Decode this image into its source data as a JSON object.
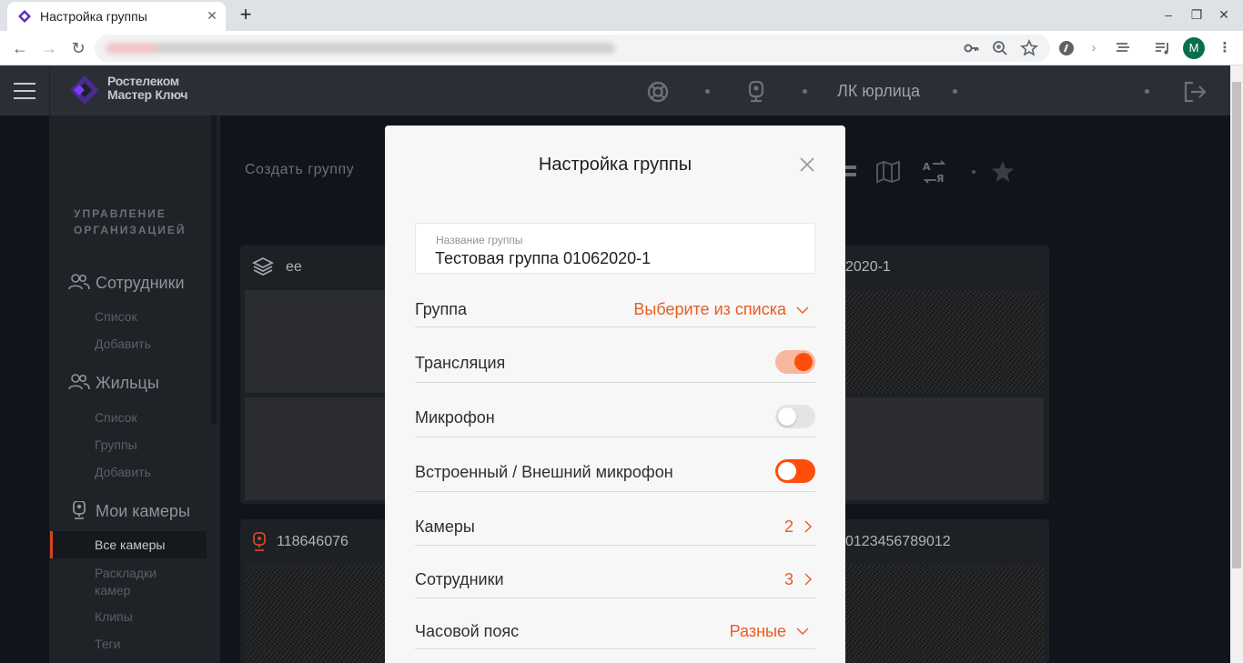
{
  "browser": {
    "tab_title": "Настройка группы",
    "tab_close": "✕",
    "new_tab": "+",
    "profile_initial": "M",
    "window_controls": [
      "–",
      "❐",
      "✕"
    ]
  },
  "header": {
    "logo_line1": "Ростелеком",
    "logo_line2": "Мастер Ключ",
    "account_label": "ЛК юрлица",
    "icons": [
      "support-icon",
      "camera-icon",
      "logout-icon"
    ]
  },
  "sidebar": {
    "heading_line1": "УПРАВЛЕНИЕ",
    "heading_line2": "ОРГАНИЗАЦИЕЙ",
    "sections": [
      {
        "label": "Сотрудники",
        "items": [
          "Список",
          "Добавить"
        ]
      },
      {
        "label": "Жильцы",
        "items": [
          "Список",
          "Группы",
          "Добавить"
        ]
      },
      {
        "label": "Мои камеры",
        "items": [
          "Все камеры",
          "Раскладки камер",
          "Клипы",
          "Теги"
        ]
      }
    ],
    "layouts_line1": "Раскладки",
    "layouts_line2": "камер",
    "active_item": "Все камеры"
  },
  "content": {
    "create_group": "Создать группу",
    "cards": [
      {
        "title": "ee"
      },
      {
        "title": "2020-1"
      },
      {
        "title": "118646076"
      },
      {
        "title": "0123456789012"
      }
    ]
  },
  "modal": {
    "title": "Настройка группы",
    "name_label": "Название группы",
    "name_value": "Тестовая группа 01062020-1",
    "group_label": "Группа",
    "group_value": "Выберите из списка",
    "broadcast_label": "Трансляция",
    "broadcast_on": true,
    "mic_label": "Микрофон",
    "mic_on": false,
    "ext_mic_label": "Встроенный / Внешний микрофон",
    "cameras_label": "Камеры",
    "cameras_count": "2",
    "employees_label": "Сотрудники",
    "employees_count": "3",
    "timezone_label": "Часовой пояс",
    "timezone_value": "Разные"
  },
  "colors": {
    "accent": "#ff4d0c",
    "accent_text": "#e85d1f",
    "header_bg": "#2b2e34",
    "sidebar_bg": "#1f2227"
  }
}
